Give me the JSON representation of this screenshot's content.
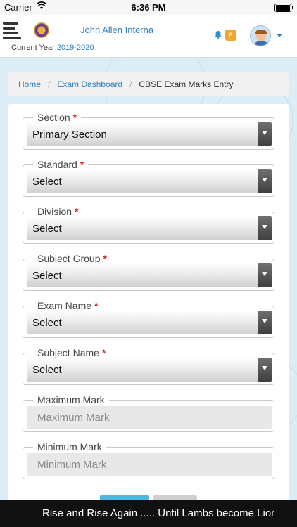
{
  "status_bar": {
    "carrier": "Carrier",
    "time": "6:36 PM",
    "wifi_icon": "wifi-icon",
    "battery_icon": "battery-icon"
  },
  "header": {
    "menu_icon": "hamburger-menu-icon",
    "logo_icon": "school-logo",
    "user_name": "John Allen Interna",
    "current_year_label": "Current Year",
    "current_year_value": "2019-2020",
    "notification_icon": "bell-icon",
    "notification_count": "8",
    "avatar_icon": "user-avatar",
    "accent_color": "#2f7fbd",
    "badge_color": "#f0a830"
  },
  "breadcrumb": {
    "items": [
      "Home",
      "Exam Dashboard",
      "CBSE Exam Marks Entry"
    ]
  },
  "form": {
    "section": {
      "label": "Section",
      "required_mark": "*",
      "value": "Primary Section"
    },
    "standard": {
      "label": "Standard",
      "required_mark": "*",
      "value": "Select"
    },
    "division": {
      "label": "Division",
      "required_mark": "*",
      "value": "Select"
    },
    "subject_group": {
      "label": "Subject Group",
      "required_mark": "*",
      "value": "Select"
    },
    "exam_name": {
      "label": "Exam Name",
      "required_mark": "*",
      "value": "Select"
    },
    "subject_name": {
      "label": "Subject Name",
      "required_mark": "*",
      "value": "Select"
    },
    "maximum_mark": {
      "label": "Maximum Mark",
      "placeholder": "Maximum Mark"
    },
    "minimum_mark": {
      "label": "Minimum Mark",
      "placeholder": "Minimum Mark"
    },
    "required_color": "#d9211e"
  },
  "footer": {
    "ticker_text": "Rise and Rise Again ..... Until Lambs become Lior"
  }
}
